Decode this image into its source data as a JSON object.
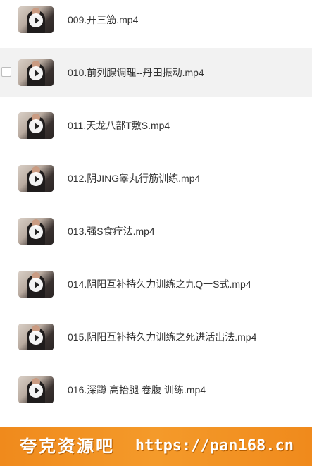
{
  "files": [
    {
      "name": "009.开三筋.mp4",
      "icon": "video-thumbnail-play-icon"
    },
    {
      "name": "010.前列腺调理--丹田振动.mp4",
      "icon": "video-thumbnail-play-icon",
      "hovered": true
    },
    {
      "name": "011.天龙八部T敷S.mp4",
      "icon": "video-thumbnail-play-icon"
    },
    {
      "name": "012.阴JING睾丸行筋训练.mp4",
      "icon": "video-thumbnail-play-icon"
    },
    {
      "name": "013.强S食疗法.mp4",
      "icon": "video-thumbnail-play-icon"
    },
    {
      "name": "014.阴阳互补持久力训练之九Q一S式.mp4",
      "icon": "video-thumbnail-play-icon"
    },
    {
      "name": "015.阴阳互补持久力训练之死进活出法.mp4",
      "icon": "video-thumbnail-play-icon"
    },
    {
      "name": "016.深蹲 高抬腿 卷腹 训练.mp4",
      "icon": "video-thumbnail-play-icon"
    }
  ],
  "watermark": {
    "name": "夸克资源吧",
    "url": "https://pan168.cn",
    "color": "#f08a1c"
  },
  "colors": {
    "hover_background": "#f2f2f2",
    "text": "#333333"
  }
}
